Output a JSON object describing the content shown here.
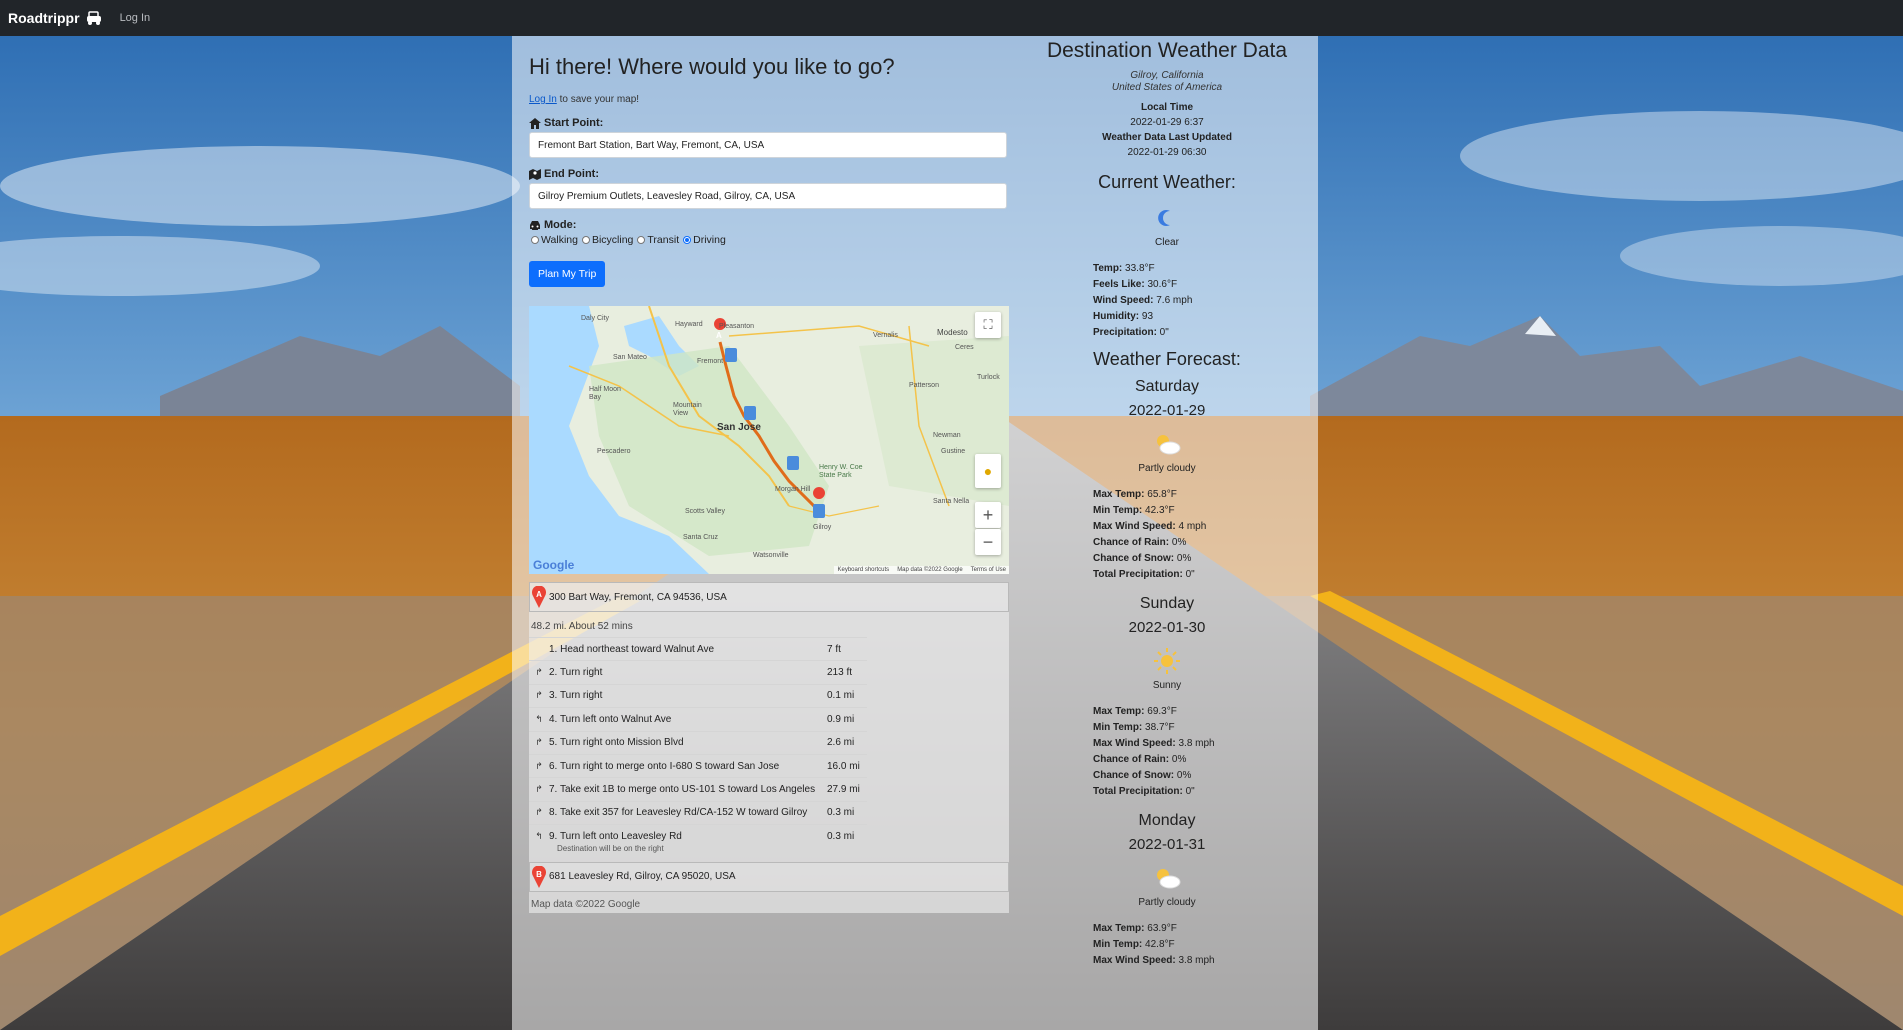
{
  "nav": {
    "brand": "Roadtrippr",
    "login": "Log In"
  },
  "planner": {
    "greeting": "Hi there! Where would you like to go?",
    "login_link": "Log In",
    "login_suffix": " to save your map!",
    "start_label": "Start Point:",
    "start_value": "Fremont Bart Station, Bart Way, Fremont, CA, USA",
    "end_label": "End Point:",
    "end_value": "Gilroy Premium Outlets, Leavesley Road, Gilroy, CA, USA",
    "mode_label": "Mode:",
    "modes": [
      "Walking",
      "Bicycling",
      "Transit",
      "Driving"
    ],
    "selected_mode": "Driving",
    "plan_button": "Plan My Trip"
  },
  "map": {
    "places": [
      "Daly City",
      "Hayward",
      "Pleasanton",
      "San Mateo",
      "Half Moon Bay",
      "Mountain View",
      "San Jose",
      "Pescadero",
      "Morgan Hill",
      "Henry W. Coe State Park",
      "Scotts Valley",
      "Santa Cruz",
      "Gilroy",
      "Watsonville",
      "Modesto",
      "Ceres",
      "Turlock",
      "Vernalis",
      "Patterson",
      "Newman",
      "Gustine",
      "Santa Nella",
      "Fremont"
    ],
    "google": "Google",
    "footer": [
      "Keyboard shortcuts",
      "Map data ©2022 Google",
      "Terms of Use"
    ],
    "marker_a": "A",
    "marker_b": "B"
  },
  "directions": {
    "start_address": "300 Bart Way, Fremont, CA 94536, USA",
    "summary": "48.2 mi. About 52 mins",
    "steps": [
      {
        "icon": "",
        "text": "1. Head northeast toward Walnut Ave",
        "dist": "7 ft"
      },
      {
        "icon": "turn-right-icon",
        "text": "2. Turn right",
        "dist": "213 ft"
      },
      {
        "icon": "turn-right-icon",
        "text": "3. Turn right",
        "dist": "0.1 mi"
      },
      {
        "icon": "turn-left-icon",
        "text": "4. Turn left onto Walnut Ave",
        "dist": "0.9 mi"
      },
      {
        "icon": "turn-right-icon",
        "text": "5. Turn right onto Mission Blvd",
        "dist": "2.6 mi"
      },
      {
        "icon": "turn-right-icon",
        "text": "6. Turn right to merge onto I-680 S toward San Jose",
        "dist": "16.0 mi"
      },
      {
        "icon": "turn-right-icon",
        "text": "7. Take exit 1B to merge onto US-101 S toward Los Angeles",
        "dist": "27.9 mi"
      },
      {
        "icon": "turn-right-icon",
        "text": "8. Take exit 357 for Leavesley Rd/CA-152 W toward Gilroy",
        "dist": "0.3 mi"
      },
      {
        "icon": "turn-left-icon",
        "text": "9. Turn left onto Leavesley Rd",
        "dist": "0.3 mi"
      }
    ],
    "step9_note": "Destination will be on the right",
    "end_address": "681 Leavesley Rd, Gilroy, CA 95020, USA",
    "attribution": "Map data ©2022 Google"
  },
  "weather": {
    "title": "Destination Weather Data",
    "city": "Gilroy, California",
    "country": "United States of America",
    "local_time_label": "Local Time",
    "local_time": "2022-01-29 6:37",
    "updated_label": "Weather Data Last Updated",
    "updated": "2022-01-29 06:30",
    "current_heading": "Current Weather:",
    "current": {
      "icon": "moon-icon",
      "condition": "Clear",
      "temp_label": "Temp:",
      "temp": " 33.8°F",
      "feels_label": "Feels Like:",
      "feels": " 30.6°F",
      "wind_label": "Wind Speed:",
      "wind": " 7.6 mph",
      "humidity_label": "Humidity:",
      "humidity": " 93",
      "precip_label": "Precipitation:",
      "precip": " 0\""
    },
    "forecast_heading": "Weather Forecast:",
    "labels": {
      "max_temp": "Max Temp:",
      "min_temp": "Min Temp:",
      "max_wind": "Max Wind Speed:",
      "rain": "Chance of Rain:",
      "snow": "Chance of Snow:",
      "total_precip": "Total Precipitation:"
    },
    "forecast": [
      {
        "day": "Saturday",
        "date": "2022-01-29",
        "icon": "partly-cloudy-icon",
        "condition": "Partly cloudy",
        "max_temp": " 65.8°F",
        "min_temp": " 42.3°F",
        "max_wind": " 4 mph",
        "rain": " 0%",
        "snow": " 0%",
        "total_precip": " 0\""
      },
      {
        "day": "Sunday",
        "date": "2022-01-30",
        "icon": "sun-icon",
        "condition": "Sunny",
        "max_temp": " 69.3°F",
        "min_temp": " 38.7°F",
        "max_wind": " 3.8 mph",
        "rain": " 0%",
        "snow": " 0%",
        "total_precip": " 0\""
      },
      {
        "day": "Monday",
        "date": "2022-01-31",
        "icon": "partly-cloudy-icon",
        "condition": "Partly cloudy",
        "max_temp": " 63.9°F",
        "min_temp": " 42.8°F",
        "max_wind": " 3.8 mph"
      }
    ]
  },
  "colors": {
    "navbar": "#212529",
    "primary": "#0d6efd",
    "road_line": "#f2b21a",
    "grass": "#c0741f"
  }
}
